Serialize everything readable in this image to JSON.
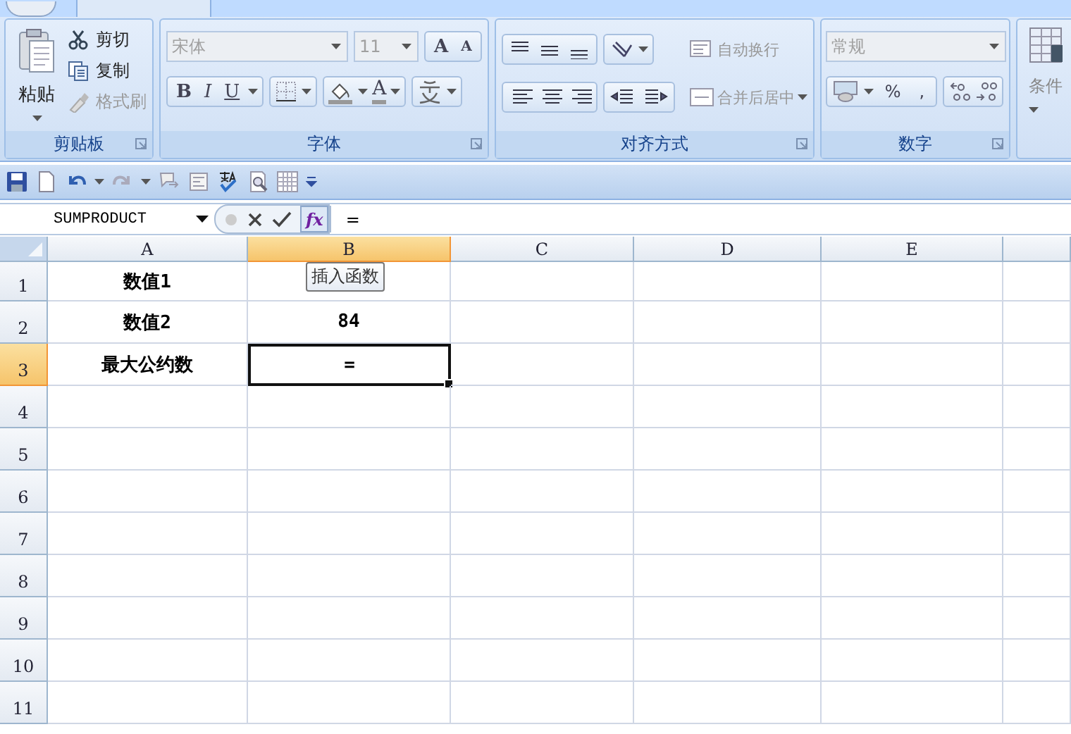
{
  "ribbon": {
    "groups": [
      {
        "kind": "clipboard",
        "label": "剪贴板",
        "paste": "粘贴",
        "items": [
          {
            "label": "剪切",
            "disabled": false
          },
          {
            "label": "复制",
            "disabled": false
          },
          {
            "label": "格式刷",
            "disabled": true
          }
        ]
      },
      {
        "kind": "font",
        "label": "字体",
        "font_name": {
          "value": "宋体",
          "disabled": true
        },
        "font_size": {
          "value": "11",
          "disabled": true
        },
        "size_buttons": [
          "A",
          "A"
        ],
        "format_buttons": [
          {
            "kind": "bold",
            "label": "B"
          },
          {
            "kind": "italic",
            "label": "I"
          },
          {
            "kind": "underline",
            "label": "U"
          }
        ],
        "font_color": "A"
      },
      {
        "kind": "align",
        "label": "对齐方式",
        "commands": [
          {
            "label": "自动换行",
            "disabled": true
          },
          {
            "label": "合并后居中",
            "disabled": true
          }
        ]
      },
      {
        "kind": "number",
        "label": "数字",
        "format": {
          "value": "常规",
          "disabled": true
        },
        "buttons": [
          "%",
          ","
        ]
      },
      {
        "kind": "partial",
        "label": "条件"
      }
    ]
  },
  "formula_bar": {
    "name_box": "SUMPRODUCT",
    "insert_function": "fx",
    "formula": "=",
    "tooltip": "插入函数"
  },
  "sheet": {
    "columns": [
      {
        "label": "A",
        "selected": false
      },
      {
        "label": "B",
        "selected": true
      },
      {
        "label": "C",
        "selected": false
      },
      {
        "label": "D",
        "selected": false
      },
      {
        "label": "E",
        "selected": false
      }
    ],
    "rows": [
      {
        "label": "1",
        "selected": false,
        "cells": [
          {
            "text": "数值1",
            "active": false
          }
        ]
      },
      {
        "label": "2",
        "selected": false,
        "cells": [
          {
            "text": "数值2",
            "active": false
          },
          {
            "text": "84",
            "active": false
          }
        ]
      },
      {
        "label": "3",
        "selected": true,
        "cells": [
          {
            "text": "最大公约数",
            "active": false
          },
          {
            "text": "=",
            "active": true
          }
        ]
      },
      {
        "label": "4",
        "selected": false
      },
      {
        "label": "5",
        "selected": false
      },
      {
        "label": "6",
        "selected": false
      },
      {
        "label": "7",
        "selected": false
      },
      {
        "label": "8",
        "selected": false
      },
      {
        "label": "9",
        "selected": false
      },
      {
        "label": "10",
        "selected": false
      },
      {
        "label": "11",
        "selected": false
      }
    ]
  }
}
